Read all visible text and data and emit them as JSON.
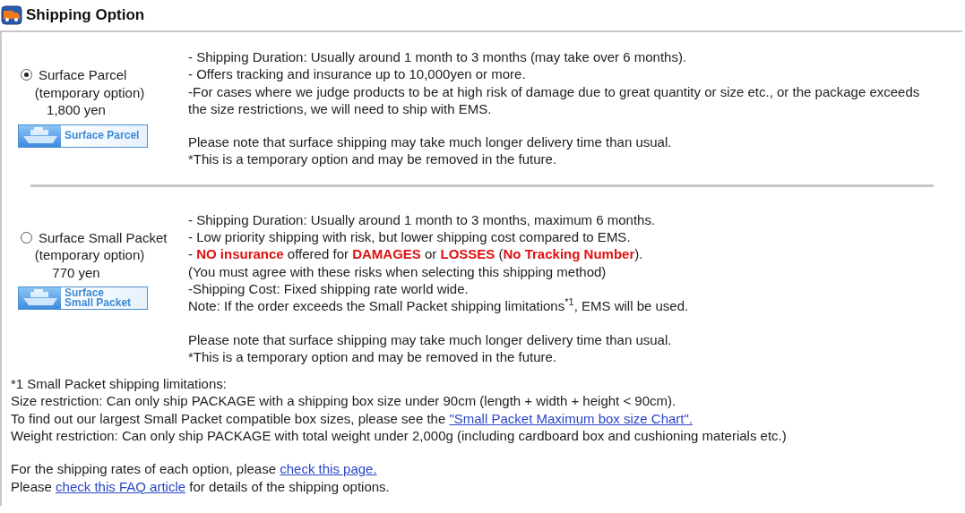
{
  "header": {
    "title": "Shipping Option"
  },
  "options": [
    {
      "label": "Surface Parcel",
      "note": "(temporary option)",
      "price": "1,800 yen",
      "selected": true,
      "banner": [
        "Surface Parcel"
      ],
      "paragraphs": [
        [
          "- Shipping Duration: Usually around 1 month to 3 months (may take over 6 months).",
          "- Offers tracking and insurance up to 10,000yen or more.",
          "-For cases where we judge products to be at high risk of damage due to great quantity or size etc., or the package exceeds the size restrictions, we will need to ship with EMS."
        ],
        [
          "Please note that surface shipping may take much longer delivery time than usual.",
          "*This is a temporary option and may be removed in the future."
        ]
      ]
    },
    {
      "label": "Surface Small Packet",
      "note": "(temporary option)",
      "price": "770 yen",
      "selected": false,
      "banner": [
        "Surface",
        "Small Packet"
      ],
      "paragraphs": [
        [
          "- Shipping Duration: Usually around 1 month to 3 months, maximum 6 months.",
          "- Low priority shipping with risk, but lower shipping cost compared to EMS.",
          "- **NO insurance** offered for **DAMAGES** or **LOSSES** (**No Tracking Number**).",
          "(You must agree with these risks when selecting this shipping method)",
          "-Shipping Cost: Fixed shipping rate world wide.",
          "Note: If the order exceeds the Small Packet shipping limitations$^{*1}$, EMS will be used."
        ],
        [
          "Please note that surface shipping may take much longer delivery time than usual.",
          "*This is a temporary option and may be removed in the future."
        ]
      ]
    }
  ],
  "footnotes": [
    [
      [
        {
          "kind": "text",
          "text": "*1 Small Packet shipping limitations:"
        }
      ],
      [
        {
          "kind": "text",
          "text": "Size restriction: Can only ship PACKAGE with a shipping box size under 90cm (length + width + height < 90cm)."
        }
      ],
      [
        {
          "kind": "text",
          "text": "To find out our largest Small Packet compatible box sizes, please see the "
        },
        {
          "kind": "link",
          "text": "\"Small Packet Maximum box size Chart\"."
        }
      ],
      [
        {
          "kind": "text",
          "text": "Weight restriction: Can only ship PACKAGE with total weight under 2,000g (including cardboard box and cushioning materials etc.)"
        }
      ]
    ],
    [
      [
        {
          "kind": "text",
          "text": "For the shipping rates of each option, please "
        },
        {
          "kind": "link",
          "text": "check this page."
        }
      ],
      [
        {
          "kind": "text",
          "text": "Please "
        },
        {
          "kind": "link",
          "text": "check this FAQ article"
        },
        {
          "kind": "text",
          "text": " for details of the shipping options."
        }
      ]
    ]
  ]
}
